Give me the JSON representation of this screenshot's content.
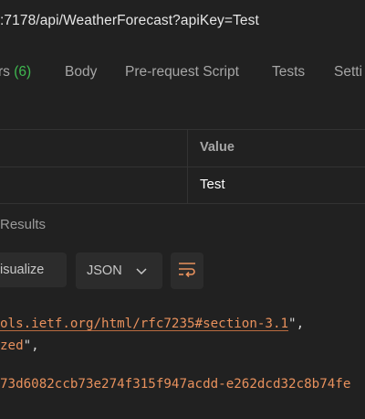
{
  "request": {
    "url": ":7178/api/WeatherForecast?apiKey=Test"
  },
  "tabs": [
    {
      "label": "rs",
      "count": "(6)"
    },
    {
      "label": "Body"
    },
    {
      "label": "Pre-request Script"
    },
    {
      "label": "Tests"
    },
    {
      "label": "Setti"
    }
  ],
  "params_table": {
    "value_header": "Value",
    "rows": [
      {
        "value": "Test"
      }
    ]
  },
  "response": {
    "results_label": "Results",
    "visualize_label": "isualize",
    "format_label": "JSON",
    "body_lines": [
      {
        "string": "ols.ietf.org/html/rfc7235#section-3.1",
        "suffix": "\","
      },
      {
        "string": "zed",
        "suffix": "\","
      },
      {
        "string": "73d6082ccb73e274f315f947acdd-e262dcd32c8b74fe",
        "suffix": ""
      }
    ]
  },
  "colors": {
    "background": "#212121",
    "count_green": "#3fb950",
    "string_orange": "#e8915d",
    "wrap_icon_orange": "#e8915d"
  },
  "icons": {
    "format_dropdown": "chevron-down-icon",
    "wrap_lines": "wrap-lines-icon"
  }
}
